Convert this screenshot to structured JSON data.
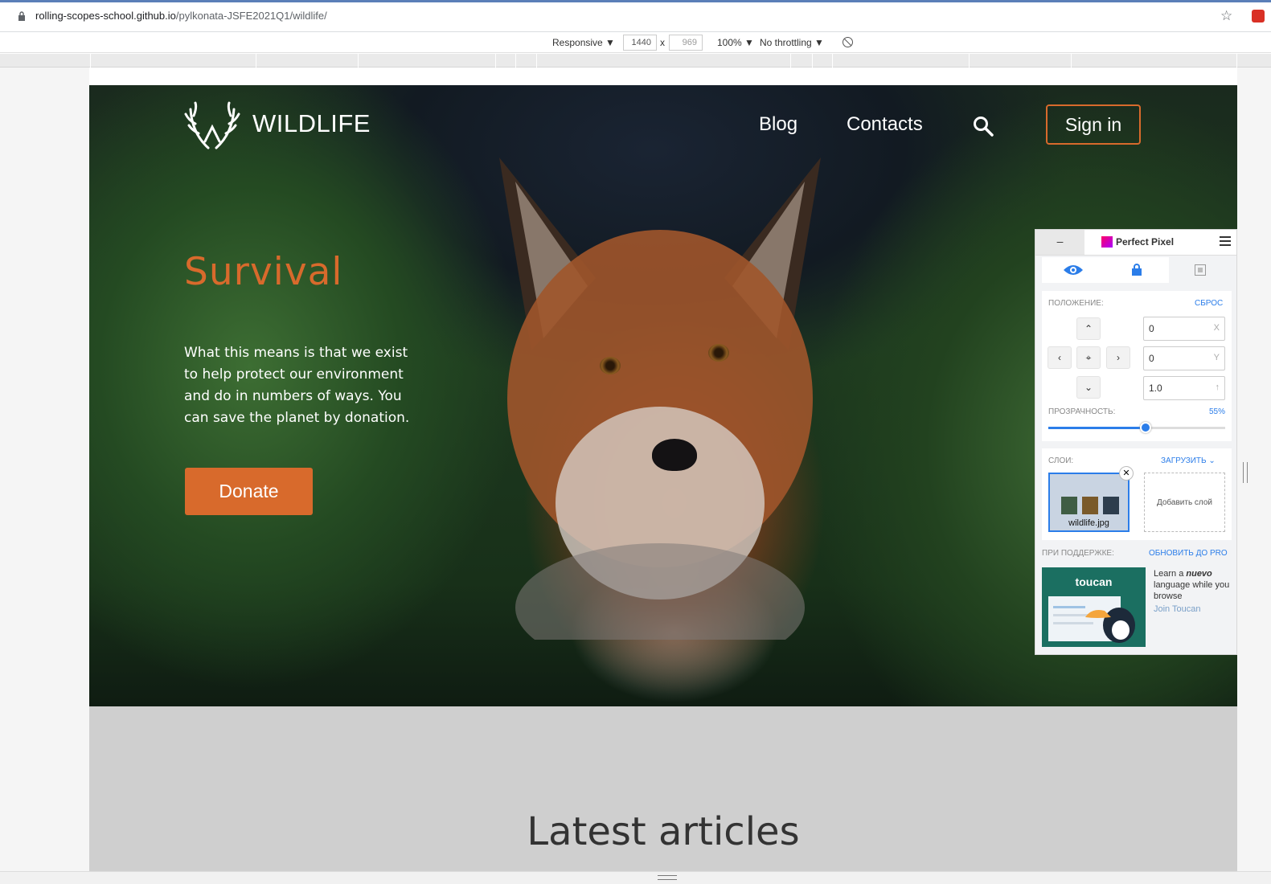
{
  "browser": {
    "url_host": "rolling-scopes-school.github.io",
    "url_path": "/pylkonata-JSFE2021Q1/wildlife/",
    "star_icon": "star-icon"
  },
  "devtools": {
    "device": "Responsive ▼",
    "width": "1440",
    "times": "x",
    "height": "969",
    "zoom": "100% ▼",
    "throttling": "No throttling ▼"
  },
  "site": {
    "logo_text": "WILDLIFE",
    "nav": [
      "Blog",
      "Contacts"
    ],
    "signin_label": "Sign in",
    "hero_title": "Survival",
    "hero_text": "What this means is that we exist to help protect our environment and do in numbers of ways. You can save the planet by donation.",
    "donate_label": "Donate",
    "articles_title": "Latest articles",
    "accent_color": "#d86a2c"
  },
  "perfect_pixel": {
    "minimize": "–",
    "title": "Perfect Pixel",
    "position_label": "ПОЛОЖЕНИЕ:",
    "reset_label": "СБРОС",
    "x_value": "0",
    "x_axis": "X",
    "y_value": "0",
    "y_axis": "Y",
    "scale_value": "1.0",
    "scale_icon": "↑",
    "opacity_label": "ПРОЗРАЧНОСТЬ:",
    "opacity_value": "55%",
    "opacity_fraction": 0.55,
    "layers_label": "СЛОИ:",
    "upload_label": "ЗАГРУЗИТЬ",
    "layer_name": "wildlife.jpg",
    "add_layer_label": "Добавить слой",
    "support_label": "ПРИ ПОДДЕРЖКЕ:",
    "upgrade_label": "ОБНОВИТЬ ДО PRO",
    "ad_brand": "toucan",
    "ad_text_pre": "Learn a ",
    "ad_text_em": "nuevo",
    "ad_text_post": " language while you browse",
    "ad_link": "Join Toucan"
  }
}
